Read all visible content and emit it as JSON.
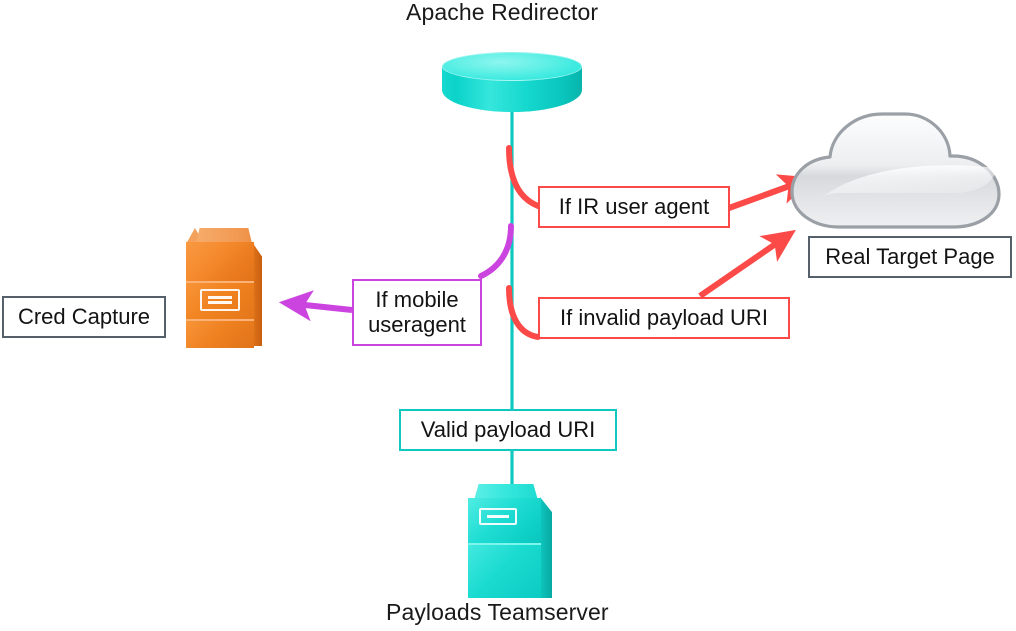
{
  "diagram": {
    "title_top": "Apache Redirector",
    "title_bottom": "Payloads Teamserver",
    "nodes": {
      "redirector": {
        "label": "Apache Redirector",
        "icon": "database-cylinder-icon",
        "color": "#17d9cf"
      },
      "teamserver": {
        "label": "Payloads Teamserver",
        "icon": "server-icon",
        "color": "#17d9cf"
      },
      "cred_server": {
        "label": "",
        "icon": "server-icon",
        "color": "#f07d22"
      },
      "cloud": {
        "label": "",
        "icon": "cloud-icon",
        "color": "#dfe1e4"
      }
    },
    "boxes": {
      "cred_capture": {
        "text": "Cred Capture",
        "border": "#55606b"
      },
      "real_target": {
        "text": "Real Target Page",
        "border": "#55606b"
      },
      "if_ir_user_agent": {
        "text": "If IR user agent",
        "border": "#fb4a47"
      },
      "if_invalid_payload_uri": {
        "text": "If invalid payload URI",
        "border": "#fb4a47"
      },
      "if_mobile_useragent_line1": "If mobile",
      "if_mobile_useragent_line2": "useragent",
      "if_mobile_useragent_border": "#cc44e0",
      "valid_payload_uri": {
        "text": "Valid payload URI",
        "border": "#0fc9c0"
      }
    },
    "edges": [
      {
        "name": "redirector-to-teamserver",
        "label": "Valid payload URI",
        "color": "#0fc9c0",
        "from": "redirector",
        "to": "teamserver"
      },
      {
        "name": "redirector-to-cloud-ir",
        "label": "If IR user agent",
        "color": "#fb4a47",
        "from": "redirector",
        "to": "cloud"
      },
      {
        "name": "redirector-to-target-invalid",
        "label": "If invalid payload URI",
        "color": "#fb4a47",
        "from": "redirector",
        "to": "real-target-page"
      },
      {
        "name": "redirector-to-cred-mobile",
        "label": "If mobile useragent",
        "color": "#cc44e0",
        "from": "redirector",
        "to": "cred_server"
      }
    ]
  }
}
